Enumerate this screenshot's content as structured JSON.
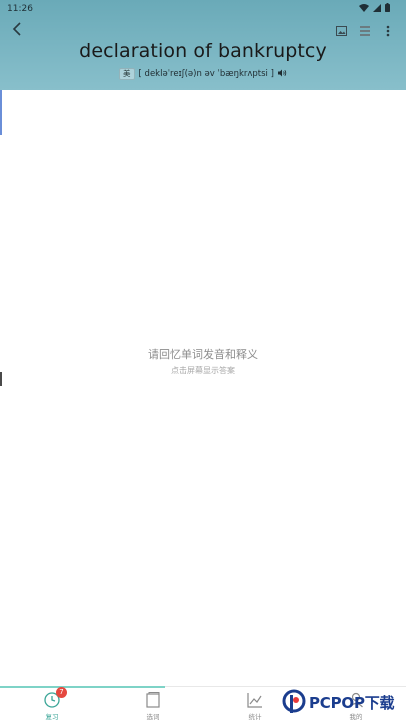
{
  "status_bar": {
    "time": "11:26"
  },
  "header": {
    "word": "declaration of bankruptcy",
    "accent": "美",
    "phonetic": "[ dekləˈreɪʃ(ə)n əv ˈbæŋkrʌptsi ]"
  },
  "prompt": {
    "main": "请回忆单词发音和释义",
    "sub": "点击屏幕显示答案"
  },
  "nav": {
    "items": [
      {
        "label": "复习",
        "badge": "7"
      },
      {
        "label": "选词"
      },
      {
        "label": "统计"
      },
      {
        "label": "我的"
      }
    ]
  },
  "colors": {
    "header_top": "#6aaab8",
    "active": "#3aa597",
    "badge": "#e5483f"
  }
}
